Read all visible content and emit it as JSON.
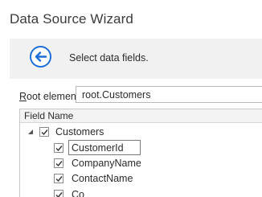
{
  "window": {
    "title": "Data Source Wizard"
  },
  "header": {
    "text": "Select data fields.",
    "back_icon": "circle-arrow-left-icon",
    "accent": "#1d6fd8"
  },
  "root_element": {
    "label_prefix": "R",
    "label_rest": "oot element:",
    "value": "root.Customers"
  },
  "grid": {
    "column_header": "Field Name",
    "parent": {
      "label": "Customers",
      "checked": true,
      "expanded": true
    },
    "children": [
      {
        "label": "CustomerId",
        "checked": true,
        "selected": true
      },
      {
        "label": "CompanyName",
        "checked": true
      },
      {
        "label": "ContactName",
        "checked": true
      },
      {
        "label": "Co",
        "checked": true
      }
    ]
  }
}
